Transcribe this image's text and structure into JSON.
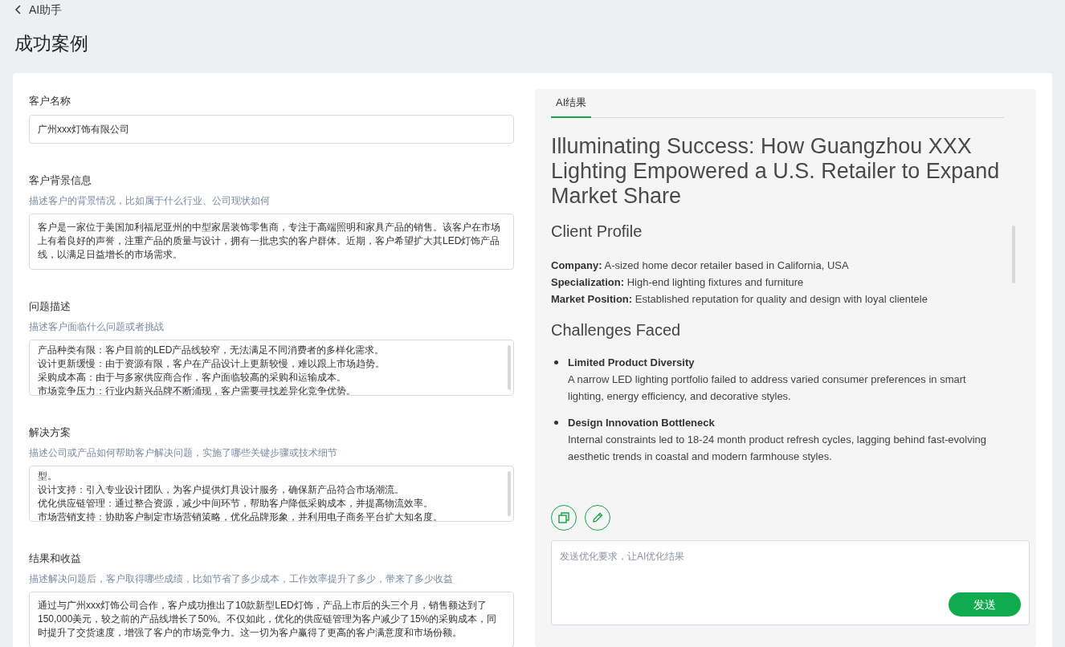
{
  "header": {
    "back_label": "AI助手",
    "title": "成功案例"
  },
  "form": {
    "fields": [
      {
        "kind": "input",
        "label": "客户名称",
        "value": "广州xxx灯饰有限公司"
      },
      {
        "kind": "paragraph",
        "label": "客户背景信息",
        "description": "描述客户的背景情况，比如属于什么行业、公司现状如何",
        "value": "客户是一家位于美国加利福尼亚州的中型家居装饰零售商，专注于高端照明和家具产品的销售。该客户在市场上有着良好的声誉，注重产品的质量与设计，拥有一批忠实的客户群体。近期，客户希望扩大其LED灯饰产品线，以满足日益增长的市场需求。"
      },
      {
        "kind": "lines",
        "label": "问题描述",
        "description": "描述客户面临什么问题或者挑战",
        "lines": [
          "产品种类有限：客户目前的LED产品线较窄，无法满足不同消费者的多样化需求。",
          "设计更新缓慢：由于资源有限，客户在产品设计上更新较慢，难以跟上市场趋势。",
          "采购成本高：由于与多家供应商合作，客户面临较高的采购和运输成本。",
          "市场竞争压力：行业内新兴品牌不断涌现，客户需要寻找差异化竞争优势。"
        ]
      },
      {
        "kind": "lines",
        "label": "解决方案",
        "description": "描述公司或产品如何帮助客户解决问题，实施了哪些关键步骤或技术细节",
        "lines": [
          "型。",
          "设计支持：引入专业设计团队，为客户提供灯具设计服务，确保新产品符合市场潮流。",
          "优化供应链管理：通过整合资源，减少中间环节，帮助客户降低采购成本，并提高物流效率。",
          "市场营销支持：协助客户制定市场营销策略，优化品牌形象，并利用电子商务平台扩大知名度。"
        ]
      },
      {
        "kind": "paragraph",
        "label": "结果和收益",
        "description": "描述解决问题后，客户取得哪些成绩，比如节省了多少成本，工作效率提升了多少，带来了多少收益",
        "value": "通过与广州xxx灯饰公司合作，客户成功推出了10款新型LED灯饰，产品上市后的头三个月，销售额达到了150,000美元，较之前的产品线增长了50%。不仅如此，优化的供应链管理为客户减少了15%的采购成本，同时提升了交货速度，增强了客户的市场竞争力。这一切为客户赢得了更高的客户满意度和市场份额。"
      }
    ]
  },
  "result": {
    "tabs": [
      {
        "label": "AI结果",
        "selected": true
      }
    ],
    "heading": "Illuminating Success: How Guangzhou XXX Lighting Empowered a U.S. Retailer to Expand Market Share",
    "sections": [
      {
        "kind": "facts",
        "title": "Client Profile",
        "items": [
          {
            "term": "Company:",
            "text": "A-sized home decor retailer based in California, USA"
          },
          {
            "term": "Specialization:",
            "text": "High-end lighting fixtures and furniture"
          },
          {
            "term": "Market Position:",
            "text": "Established reputation for quality and design with loyal clientele"
          }
        ]
      },
      {
        "kind": "bullets",
        "title": "Challenges Faced",
        "items": [
          {
            "term": "Limited Product Diversity",
            "text": "A narrow LED lighting portfolio failed to address varied consumer preferences in smart lighting, energy efficiency, and decorative styles."
          },
          {
            "term": "Design Innovation Bottleneck",
            "text": "Internal constraints led to 18-24 month product refresh cycles, lagging behind fast-evolving aesthetic trends in coastal and modern farmhouse styles."
          }
        ]
      }
    ],
    "prompt": {
      "placeholder": "发送优化要求，让AI优化结果"
    },
    "send_button": "发送"
  }
}
